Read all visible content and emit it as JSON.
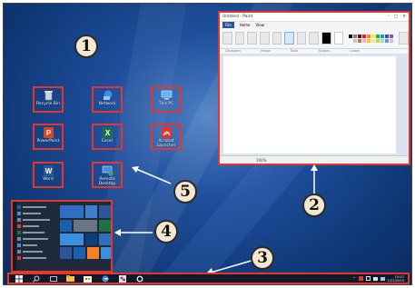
{
  "callouts": [
    "1",
    "2",
    "3",
    "4",
    "5"
  ],
  "paint": {
    "title": "Untitled - Paint",
    "tabs": [
      "File",
      "Home",
      "View"
    ],
    "groups": [
      "Clipboard",
      "Image",
      "Tools",
      "Shapes",
      "Colors"
    ],
    "status": "100%",
    "colors": [
      "#000000",
      "#7f7f7f",
      "#880015",
      "#ed1c24",
      "#ff7f27",
      "#fff200",
      "#22b14c",
      "#00a2e8",
      "#3f48cc",
      "#a349a4",
      "#ffffff",
      "#c3c3c3",
      "#b97a57",
      "#ffaec9",
      "#ffc90e",
      "#efe4b0",
      "#b5e61d",
      "#99d9ea",
      "#7092be",
      "#c8bfe7"
    ]
  },
  "desktop_icons": [
    {
      "label": "Recycle Bin",
      "icon": "recycle-bin-icon"
    },
    {
      "label": "Network",
      "icon": "network-icon"
    },
    {
      "label": "This PC",
      "icon": "this-pc-icon"
    },
    {
      "label": "PowerPoint",
      "icon": "powerpoint-icon"
    },
    {
      "label": "Excel",
      "icon": "excel-icon"
    },
    {
      "label": "Acrobat Launcher",
      "icon": "acrobat-icon"
    },
    {
      "label": "Word",
      "icon": "word-icon"
    },
    {
      "label": "Remote Desktop",
      "icon": "remote-desktop-icon"
    }
  ],
  "colors": {
    "highlight": "#e4372b",
    "desktop": "#1f4f9c",
    "taskbar": "#101a2b"
  },
  "taskbar": {
    "items": [
      "start-icon",
      "search-icon",
      "task-view-icon",
      "file-explorer-icon",
      "store-icon",
      "edge-icon",
      "paint-icon",
      "settings-icon"
    ],
    "clock_time": "10:07",
    "clock_date": "1/22/2019"
  }
}
